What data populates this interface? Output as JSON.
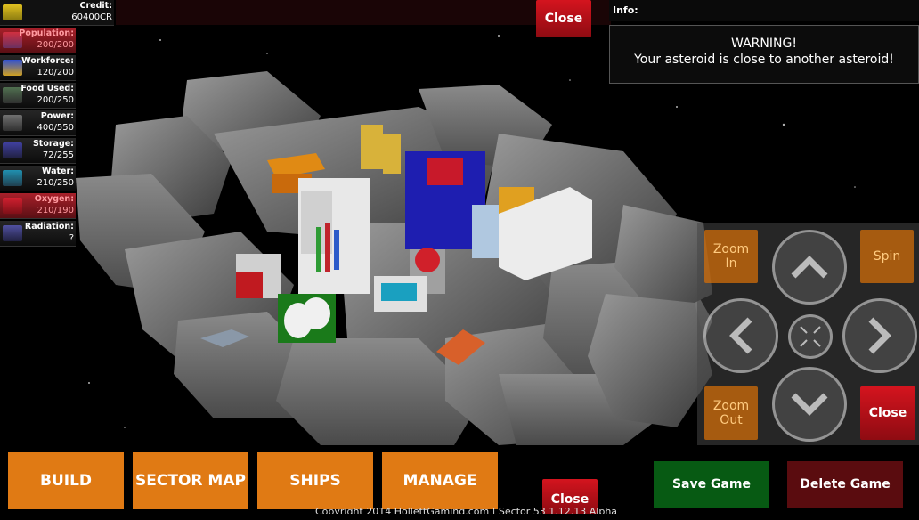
{
  "stats": {
    "credit": {
      "label": "Credit:",
      "value": "60400CR"
    },
    "population": {
      "label": "Population:",
      "value": "200/200"
    },
    "workforce": {
      "label": "Workforce:",
      "value": "120/200"
    },
    "food": {
      "label": "Food Used:",
      "value": "200/250"
    },
    "power": {
      "label": "Power:",
      "value": "400/550"
    },
    "storage": {
      "label": "Storage:",
      "value": "72/255"
    },
    "water": {
      "label": "Water:",
      "value": "210/250"
    },
    "oxygen": {
      "label": "Oxygen:",
      "value": "210/190"
    },
    "radiation": {
      "label": "Radiation:",
      "value": "?"
    }
  },
  "top_close": "Close",
  "info": {
    "title": "Info:",
    "line1": "WARNING!",
    "line2": "Your asteroid is close to another asteroid!"
  },
  "controls": {
    "zoom_in": [
      "Zoom",
      "In"
    ],
    "zoom_out": [
      "Zoom",
      "Out"
    ],
    "spin": "Spin",
    "close": "Close"
  },
  "bottom": {
    "build": "BUILD",
    "sector_map": "SECTOR MAP",
    "ships": "SHIPS",
    "manage": "MANAGE",
    "close": "Close",
    "save": "Save Game",
    "delete": "Delete Game",
    "copyright": "Copyright 2014 HollettGaming.com | Sector 53 1.12.13 Alpha"
  }
}
